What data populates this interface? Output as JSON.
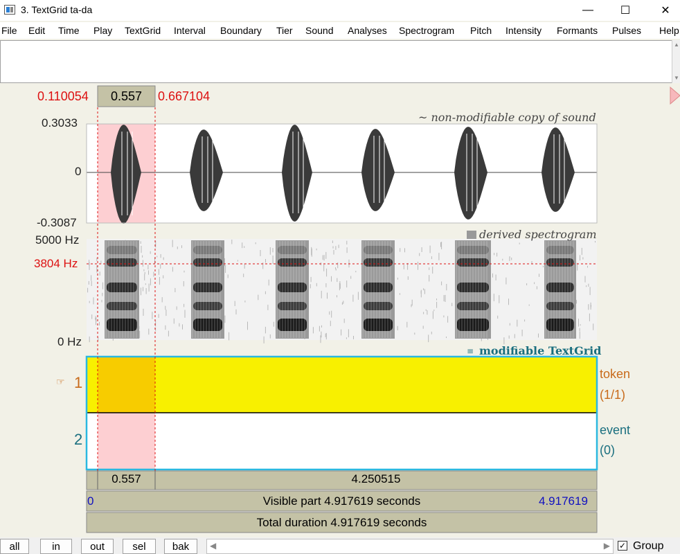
{
  "window": {
    "title": "3. TextGrid ta-da",
    "minimize": "—",
    "maximize": "☐",
    "close": "✕"
  },
  "menu": [
    "File",
    "Edit",
    "Time",
    "Play",
    "TextGrid",
    "Interval",
    "Boundary",
    "Tier",
    "Sound",
    "Analyses",
    "Spectrogram",
    "Pitch",
    "Intensity",
    "Formants",
    "Pulses",
    "Help"
  ],
  "selection": {
    "start": "0.110054",
    "duration": "0.557",
    "end": "0.667104"
  },
  "waveform": {
    "title": "~ non-modifiable copy of sound",
    "max": "0.3033",
    "zero": "0",
    "min": "-0.3087"
  },
  "spectrogram": {
    "title": "derived spectrogram",
    "max": "5000 Hz",
    "cursor": "3804 Hz",
    "min": "0 Hz"
  },
  "textgrid": {
    "title": "modifiable TextGrid",
    "tiers": [
      {
        "number": "1",
        "name": "token",
        "count": "(1/1)",
        "pointer": "☞"
      },
      {
        "number": "2",
        "name": "event",
        "count": "(0)"
      }
    ]
  },
  "time_bars": {
    "selected": "0.557",
    "remaining": "4.250515",
    "visible_start": "0",
    "visible_text": "Visible part 4.917619 seconds",
    "visible_end": "4.917619",
    "total_text": "Total duration 4.917619 seconds"
  },
  "buttons": {
    "all": "all",
    "in": "in",
    "out": "out",
    "sel": "sel",
    "bak": "bak"
  },
  "group": {
    "label": "Group",
    "checked": "✓"
  },
  "colors": {
    "selection_fill": "#fdcfd2",
    "tier_fill": "#f8f000",
    "tier_selected_fill": "#f7cc00",
    "frame_cyan": "#2ab8e0",
    "red": "#dd1111",
    "blue": "#1010c0",
    "time_bar": "#c4c2a6"
  }
}
